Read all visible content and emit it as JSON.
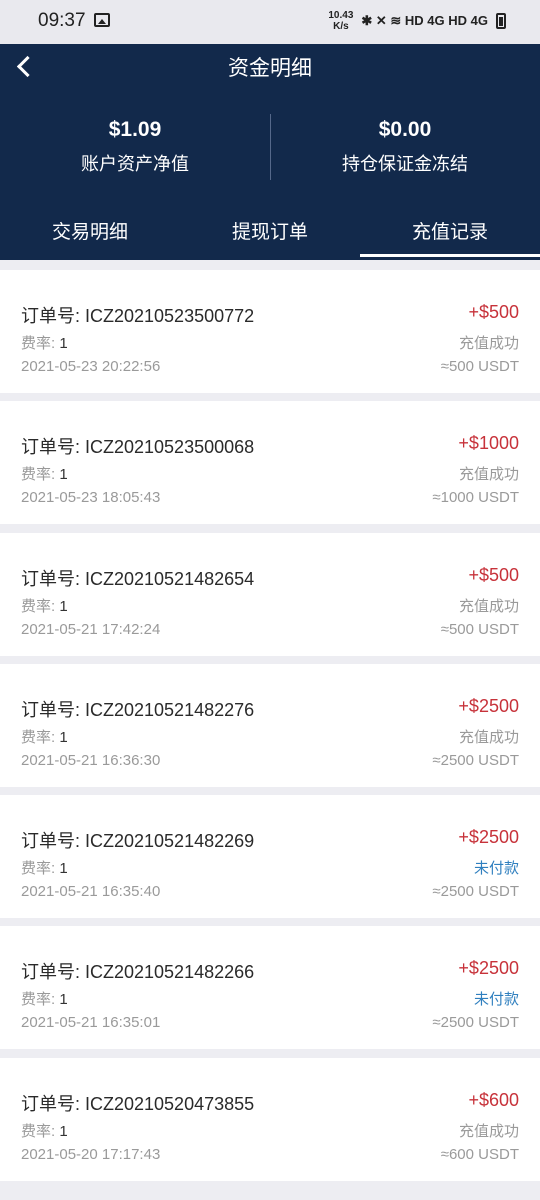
{
  "status_bar": {
    "time": "09:37",
    "net_speed_top": "10.43",
    "net_speed_bottom": "K/s",
    "icons_text": "✱ ✕ ≋ HD 4G HD 4G"
  },
  "nav": {
    "title": "资金明细"
  },
  "summary": [
    {
      "value": "$1.09",
      "label": "账户资产净值"
    },
    {
      "value": "$0.00",
      "label": "持仓保证金冻结"
    }
  ],
  "tabs": [
    "交易明细",
    "提现订单",
    "充值记录"
  ],
  "active_tab": 2,
  "colors": {
    "header_bg": "#12294b",
    "amount": "#c7323a",
    "status_success": "#9a9a9a",
    "status_unpaid": "#2f7fbf"
  },
  "labels": {
    "fee_prefix": "费率: "
  },
  "records": [
    {
      "order": "订单号: ICZ20210523500772",
      "fee": "1",
      "time": "2021-05-23 20:22:56",
      "amount": "+$500",
      "status": "充值成功",
      "usdt": "≈500 USDT",
      "unpaid": false
    },
    {
      "order": "订单号: ICZ20210523500068",
      "fee": "1",
      "time": "2021-05-23 18:05:43",
      "amount": "+$1000",
      "status": "充值成功",
      "usdt": "≈1000 USDT",
      "unpaid": false
    },
    {
      "order": "订单号: ICZ20210521482654",
      "fee": "1",
      "time": "2021-05-21 17:42:24",
      "amount": "+$500",
      "status": "充值成功",
      "usdt": "≈500 USDT",
      "unpaid": false
    },
    {
      "order": "订单号: ICZ20210521482276",
      "fee": "1",
      "time": "2021-05-21 16:36:30",
      "amount": "+$2500",
      "status": "充值成功",
      "usdt": "≈2500 USDT",
      "unpaid": false
    },
    {
      "order": "订单号: ICZ20210521482269",
      "fee": "1",
      "time": "2021-05-21 16:35:40",
      "amount": "+$2500",
      "status": "未付款",
      "usdt": "≈2500 USDT",
      "unpaid": true
    },
    {
      "order": "订单号: ICZ20210521482266",
      "fee": "1",
      "time": "2021-05-21 16:35:01",
      "amount": "+$2500",
      "status": "未付款",
      "usdt": "≈2500 USDT",
      "unpaid": true
    },
    {
      "order": "订单号: ICZ20210520473855",
      "fee": "1",
      "time": "2021-05-20 17:17:43",
      "amount": "+$600",
      "status": "充值成功",
      "usdt": "≈600 USDT",
      "unpaid": false
    }
  ]
}
